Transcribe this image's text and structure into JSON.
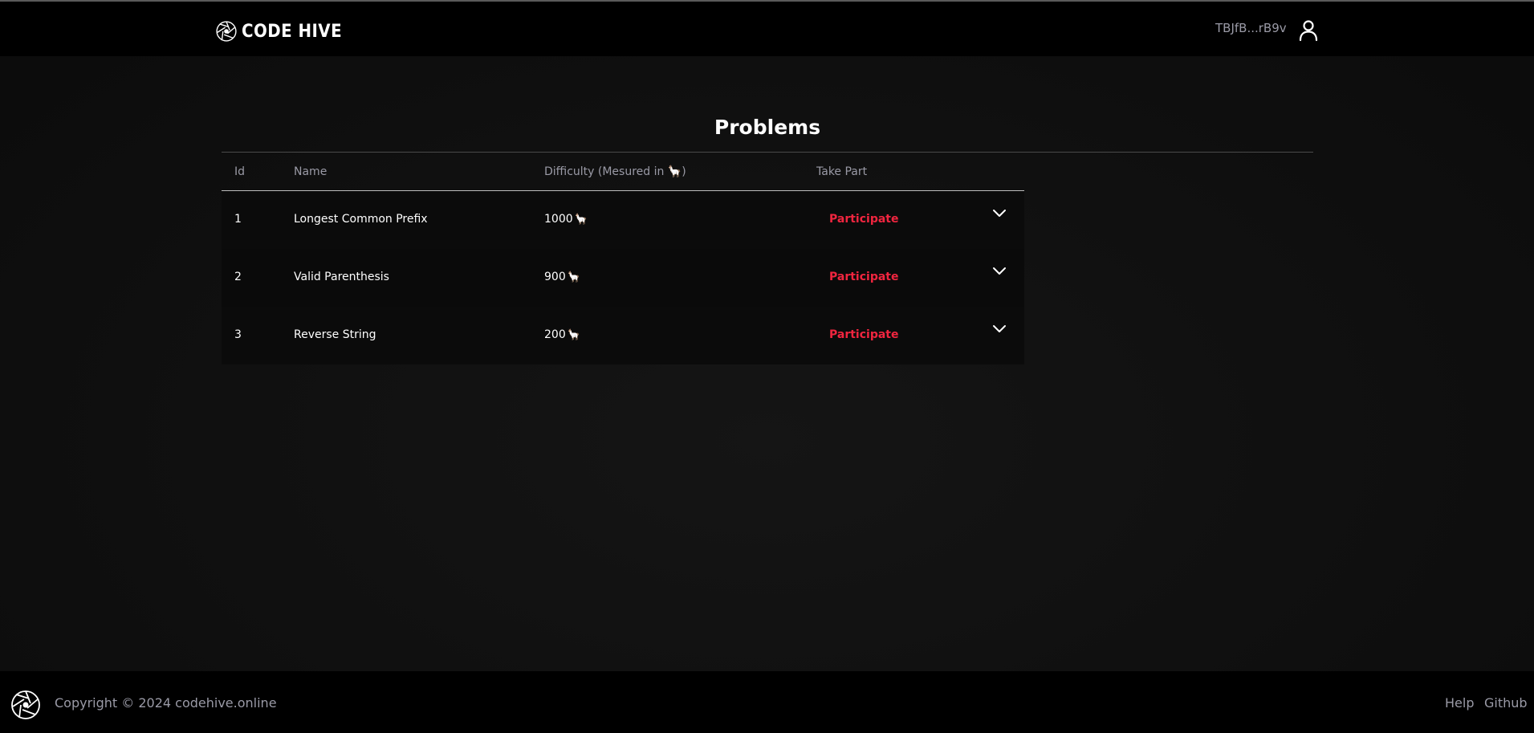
{
  "header": {
    "brand": "CODE HIVE",
    "wallet_address": "TBJfB...rB9v",
    "icons": {
      "logo": "aperture-logo-icon",
      "user": "user-icon"
    }
  },
  "main": {
    "title": "Problems",
    "table": {
      "columns": [
        "Id",
        "Name",
        "Difficulty (Mesured in 🦙)",
        "Take Part"
      ],
      "rows": [
        {
          "id": "1",
          "name": "Longest Common Prefix",
          "difficulty": "1000",
          "unit": "🦙",
          "action": "Participate"
        },
        {
          "id": "2",
          "name": "Valid Parenthesis",
          "difficulty": "900",
          "unit": "🦙",
          "action": "Participate"
        },
        {
          "id": "3",
          "name": "Reverse String",
          "difficulty": "200",
          "unit": "🦙",
          "action": "Participate"
        }
      ],
      "expand_icon": "chevron-down-icon"
    }
  },
  "footer": {
    "copyright": "Copyright © 2024 codehive.online",
    "links": {
      "help": "Help",
      "github": "Github"
    }
  },
  "colors": {
    "accent": "#f0253f",
    "background": "#0f0f0f",
    "bar": "#000000",
    "muted_text": "#9a9aa6"
  }
}
